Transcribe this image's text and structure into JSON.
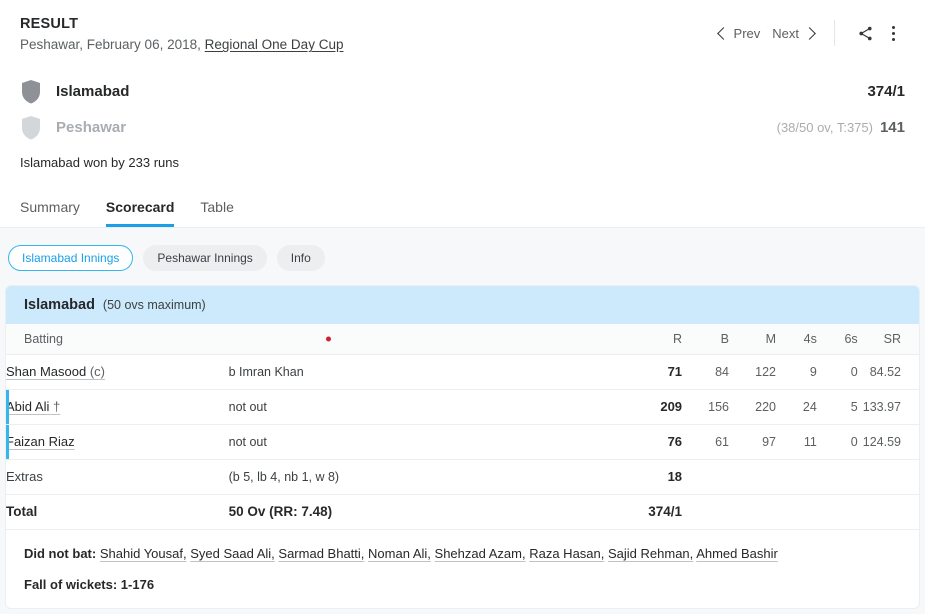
{
  "header": {
    "result_label": "RESULT",
    "venue_date": "Peshawar, February 06, 2018, ",
    "series": "Regional One Day Cup",
    "prev_label": "Prev",
    "next_label": "Next",
    "share_icon": "share-icon",
    "menu_icon": "kebab-menu-icon"
  },
  "teams": [
    {
      "name": "Islamabad",
      "score": "374/1",
      "detail": "",
      "dim": false
    },
    {
      "name": "Peshawar",
      "score": "141",
      "detail": "(38/50 ov, T:375)",
      "dim": true
    }
  ],
  "result_text": "Islamabad won by 233 runs",
  "tabs": [
    {
      "label": "Summary",
      "active": false
    },
    {
      "label": "Scorecard",
      "active": true
    },
    {
      "label": "Table",
      "active": false
    }
  ],
  "pills": [
    {
      "label": "Islamabad Innings",
      "active": true
    },
    {
      "label": "Peshawar Innings",
      "active": false
    },
    {
      "label": "Info",
      "active": false
    }
  ],
  "innings": {
    "team": "Islamabad",
    "overs_note": "(50 ovs maximum)",
    "columns": {
      "batting": "Batting",
      "r": "R",
      "b": "B",
      "m": "M",
      "fours": "4s",
      "sixes": "6s",
      "sr": "SR"
    },
    "batsmen": [
      {
        "name": "Shan Masood",
        "suffix": " (c)",
        "dismissal": "b Imran Khan",
        "r": "71",
        "b": "84",
        "m": "122",
        "fours": "9",
        "sixes": "0",
        "sr": "84.52",
        "not_out": false
      },
      {
        "name": "Abid Ali",
        "suffix": " †",
        "dismissal": "not out",
        "r": "209",
        "b": "156",
        "m": "220",
        "fours": "24",
        "sixes": "5",
        "sr": "133.97",
        "not_out": true
      },
      {
        "name": "Faizan Riaz",
        "suffix": "",
        "dismissal": "not out",
        "r": "76",
        "b": "61",
        "m": "97",
        "fours": "11",
        "sixes": "0",
        "sr": "124.59",
        "not_out": true
      }
    ],
    "extras": {
      "label": "Extras",
      "detail": "(b 5, lb 4, nb 1, w 8)",
      "value": "18"
    },
    "total": {
      "label": "Total",
      "detail": "50 Ov (RR: 7.48)",
      "value": "374/1"
    },
    "did_not_bat_label": "Did not bat:",
    "did_not_bat": [
      "Shahid Yousaf",
      "Syed Saad Ali",
      "Sarmad Bhatti",
      "Noman Ali",
      "Shehzad Azam",
      "Raza Hasan",
      "Sajid Rehman",
      "Ahmed Bashir"
    ],
    "fall_of_wickets": "Fall of wickets: 1-176"
  },
  "colors": {
    "accent_blue": "#1ba0e8",
    "band_blue": "#cdeafd",
    "pill_border": "#35b6ef",
    "red_dot": "#cc2233",
    "page_bg": "#f7f8f9"
  }
}
